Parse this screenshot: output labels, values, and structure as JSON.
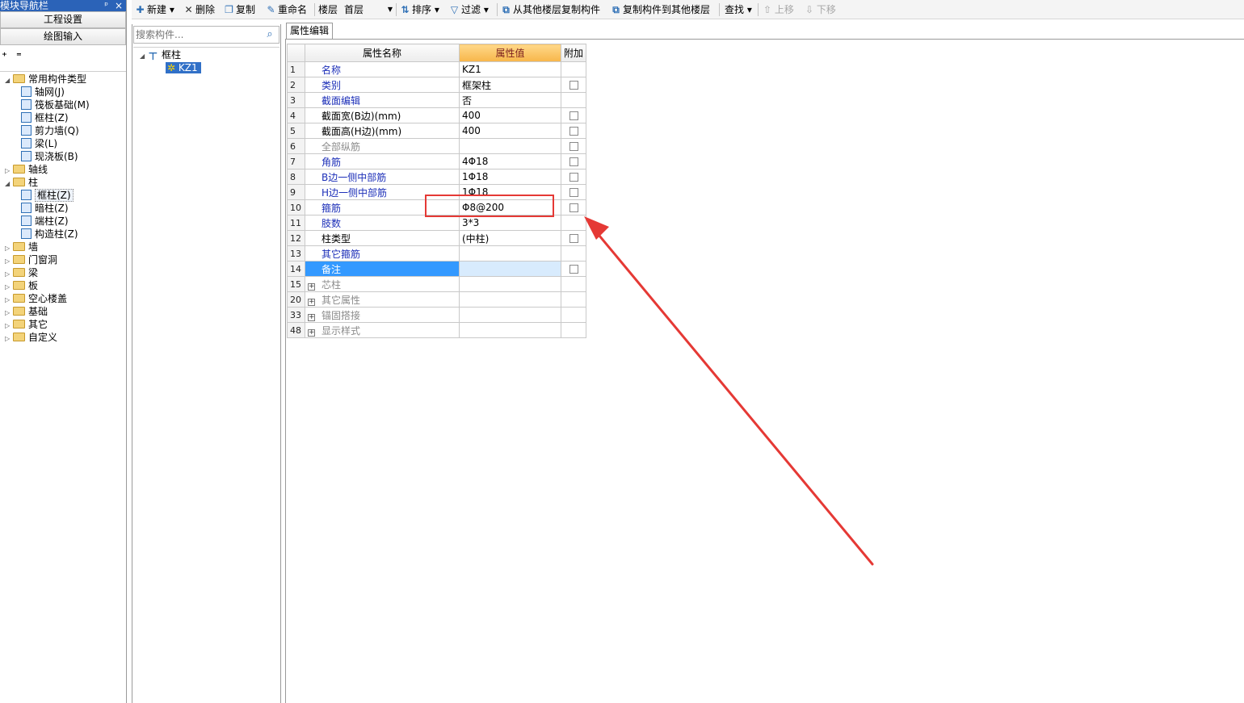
{
  "nav": {
    "title": "模块导航栏",
    "pin": "ᵖ",
    "close": "×",
    "btn_project": "工程设置",
    "btn_draw": "绘图输入",
    "tree": [
      {
        "label": "常用构件类型",
        "kind": "folder",
        "open": true
      },
      {
        "label": "轴网(J)",
        "kind": "item"
      },
      {
        "label": "筏板基础(M)",
        "kind": "item"
      },
      {
        "label": "框柱(Z)",
        "kind": "item"
      },
      {
        "label": "剪力墙(Q)",
        "kind": "item"
      },
      {
        "label": "梁(L)",
        "kind": "item"
      },
      {
        "label": "现浇板(B)",
        "kind": "item"
      },
      {
        "label": "轴线",
        "kind": "folder"
      },
      {
        "label": "柱",
        "kind": "folder",
        "open": true
      },
      {
        "label": "框柱(Z)",
        "kind": "item",
        "selected": true
      },
      {
        "label": "暗柱(Z)",
        "kind": "item"
      },
      {
        "label": "端柱(Z)",
        "kind": "item"
      },
      {
        "label": "构造柱(Z)",
        "kind": "item"
      },
      {
        "label": "墙",
        "kind": "folder"
      },
      {
        "label": "门窗洞",
        "kind": "folder"
      },
      {
        "label": "梁",
        "kind": "folder"
      },
      {
        "label": "板",
        "kind": "folder"
      },
      {
        "label": "空心楼盖",
        "kind": "folder"
      },
      {
        "label": "基础",
        "kind": "folder"
      },
      {
        "label": "其它",
        "kind": "folder"
      },
      {
        "label": "自定义",
        "kind": "folder"
      }
    ]
  },
  "toolbar": {
    "new": "新建",
    "delete": "删除",
    "copy": "复制",
    "rename": "重命名",
    "floor_label": "楼层",
    "floor_value": "首层",
    "sort": "排序",
    "filter": "过滤",
    "copy_from": "从其他楼层复制构件",
    "copy_to": "复制构件到其他楼层",
    "find": "查找",
    "up": "上移",
    "down": "下移"
  },
  "list": {
    "search_placeholder": "搜索构件...",
    "root": "框柱",
    "child": "KZ1"
  },
  "props": {
    "tab": "属性编辑",
    "col_name": "属性名称",
    "col_value": "属性值",
    "col_extra": "附加",
    "rows": [
      {
        "idx": "1",
        "name": "名称",
        "value": "KZ1",
        "style": "blue",
        "check": false
      },
      {
        "idx": "2",
        "name": "类别",
        "value": "框架柱",
        "style": "blue",
        "check": true
      },
      {
        "idx": "3",
        "name": "截面编辑",
        "value": "否",
        "style": "blue",
        "check": false
      },
      {
        "idx": "4",
        "name": "截面宽(B边)(mm)",
        "value": "400",
        "style": "black",
        "check": true
      },
      {
        "idx": "5",
        "name": "截面高(H边)(mm)",
        "value": "400",
        "style": "black",
        "check": true
      },
      {
        "idx": "6",
        "name": "全部纵筋",
        "value": "",
        "style": "gray",
        "check": true
      },
      {
        "idx": "7",
        "name": "角筋",
        "value": "4Φ18",
        "style": "blue",
        "check": true
      },
      {
        "idx": "8",
        "name": "B边一侧中部筋",
        "value": "1Φ18",
        "style": "blue",
        "check": true
      },
      {
        "idx": "9",
        "name": "H边一侧中部筋",
        "value": "1Φ18",
        "style": "blue",
        "check": true
      },
      {
        "idx": "10",
        "name": "箍筋",
        "value": "Φ8@200",
        "style": "blue",
        "check": true
      },
      {
        "idx": "11",
        "name": "肢数",
        "value": "3*3",
        "style": "blue",
        "check": false
      },
      {
        "idx": "12",
        "name": "柱类型",
        "value": "(中柱)",
        "style": "black",
        "check": true
      },
      {
        "idx": "13",
        "name": "其它箍筋",
        "value": "",
        "style": "blue",
        "check": false
      },
      {
        "idx": "14",
        "name": "备注",
        "value": "",
        "style": "black",
        "check": true,
        "selected": true
      },
      {
        "idx": "15",
        "name": "芯柱",
        "value": "",
        "style": "gray",
        "check": false,
        "group": true
      },
      {
        "idx": "20",
        "name": "其它属性",
        "value": "",
        "style": "gray",
        "check": false,
        "group": true
      },
      {
        "idx": "33",
        "name": "锚固搭接",
        "value": "",
        "style": "gray",
        "check": false,
        "group": true
      },
      {
        "idx": "48",
        "name": "显示样式",
        "value": "",
        "style": "gray",
        "check": false,
        "group": true
      }
    ]
  },
  "colors": {
    "title_bar": "#2b63b8",
    "annotation": "#e53935",
    "selected_row": "#3399ff"
  }
}
